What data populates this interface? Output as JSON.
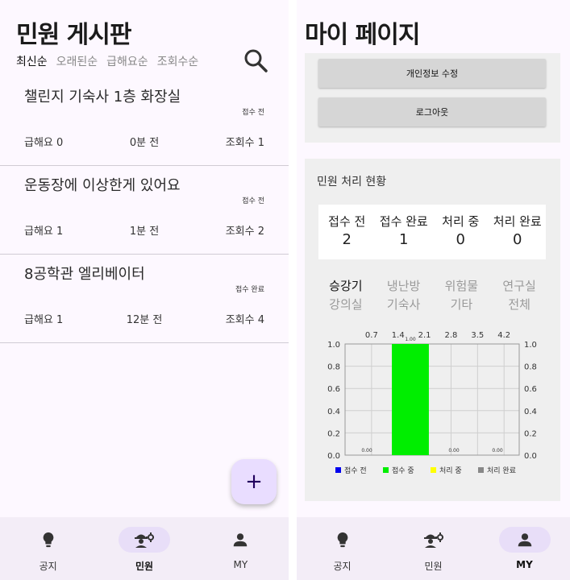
{
  "board": {
    "title": "민원 게시판",
    "sort_tabs": [
      "최신순",
      "오래된순",
      "급해요순",
      "조회수순"
    ],
    "active_sort_index": 0,
    "search_icon": "search-icon",
    "posts": [
      {
        "title": "챌린지 기숙사 1층 화장실",
        "status": "접수 전",
        "urgent": "급해요 0",
        "time": "0분 전",
        "views": "조회수 1"
      },
      {
        "title": "운동장에 이상한게 있어요",
        "status": "접수 전",
        "urgent": "급해요 1",
        "time": "1분 전",
        "views": "조회수 2"
      },
      {
        "title": "8공학관 엘리베이터",
        "status": "접수 완료",
        "urgent": "급해요 1",
        "time": "12분 전",
        "views": "조회수 4"
      }
    ],
    "fab_label": "+"
  },
  "mypage": {
    "title": "마이 페이지",
    "edit_info_label": "개인정보 수정",
    "logout_label": "로그아웃",
    "status_heading": "민원 처리 현황",
    "status_items": [
      {
        "label": "접수 전",
        "count": "2"
      },
      {
        "label": "접수 완료",
        "count": "1"
      },
      {
        "label": "처리 중",
        "count": "0"
      },
      {
        "label": "처리 완료",
        "count": "0"
      }
    ],
    "place_tabs": [
      "승강기",
      "냉난방",
      "위험물",
      "연구실",
      "강의실",
      "기숙사",
      "기타",
      "전체"
    ],
    "active_place_index": 0
  },
  "nav_left": {
    "items": [
      {
        "label": "공지",
        "icon": "lightbulb-icon"
      },
      {
        "label": "민원",
        "icon": "engineering-icon"
      },
      {
        "label": "MY",
        "icon": "person-icon"
      }
    ],
    "active_index": 1
  },
  "nav_right": {
    "items": [
      {
        "label": "공지",
        "icon": "lightbulb-icon"
      },
      {
        "label": "민원",
        "icon": "engineering-icon"
      },
      {
        "label": "MY",
        "icon": "person-icon"
      }
    ],
    "active_index": 2
  },
  "colors": {
    "active_pill": "#e8def8",
    "fab": "#e9ddff",
    "card_bg": "#efefef",
    "button_bg": "#d6d6d6"
  },
  "chart_data": {
    "type": "bar",
    "categories": [
      "접수 전",
      "접수 중",
      "처리 중",
      "처리 완료"
    ],
    "values": [
      0.0,
      1.0,
      0.0,
      0.0
    ],
    "value_labels": [
      "0.00",
      "1.00",
      "0.00",
      "0.00"
    ],
    "series_colors": [
      "#0000ee",
      "#00ee00",
      "#ffff00",
      "#888888"
    ],
    "top_ticks": [
      "0.7",
      "1.4",
      "2.1",
      "2.8",
      "3.5",
      "4.2"
    ],
    "left_ticks": [
      "1.0",
      "0.8",
      "0.6",
      "0.4",
      "0.2",
      "0.0"
    ],
    "right_ticks": [
      "1.0",
      "0.8",
      "0.6",
      "0.4",
      "0.2",
      "0.0"
    ],
    "ylim": [
      0,
      1
    ],
    "xlim": [
      0,
      4.6
    ],
    "grid": true,
    "legend": "bottom"
  }
}
